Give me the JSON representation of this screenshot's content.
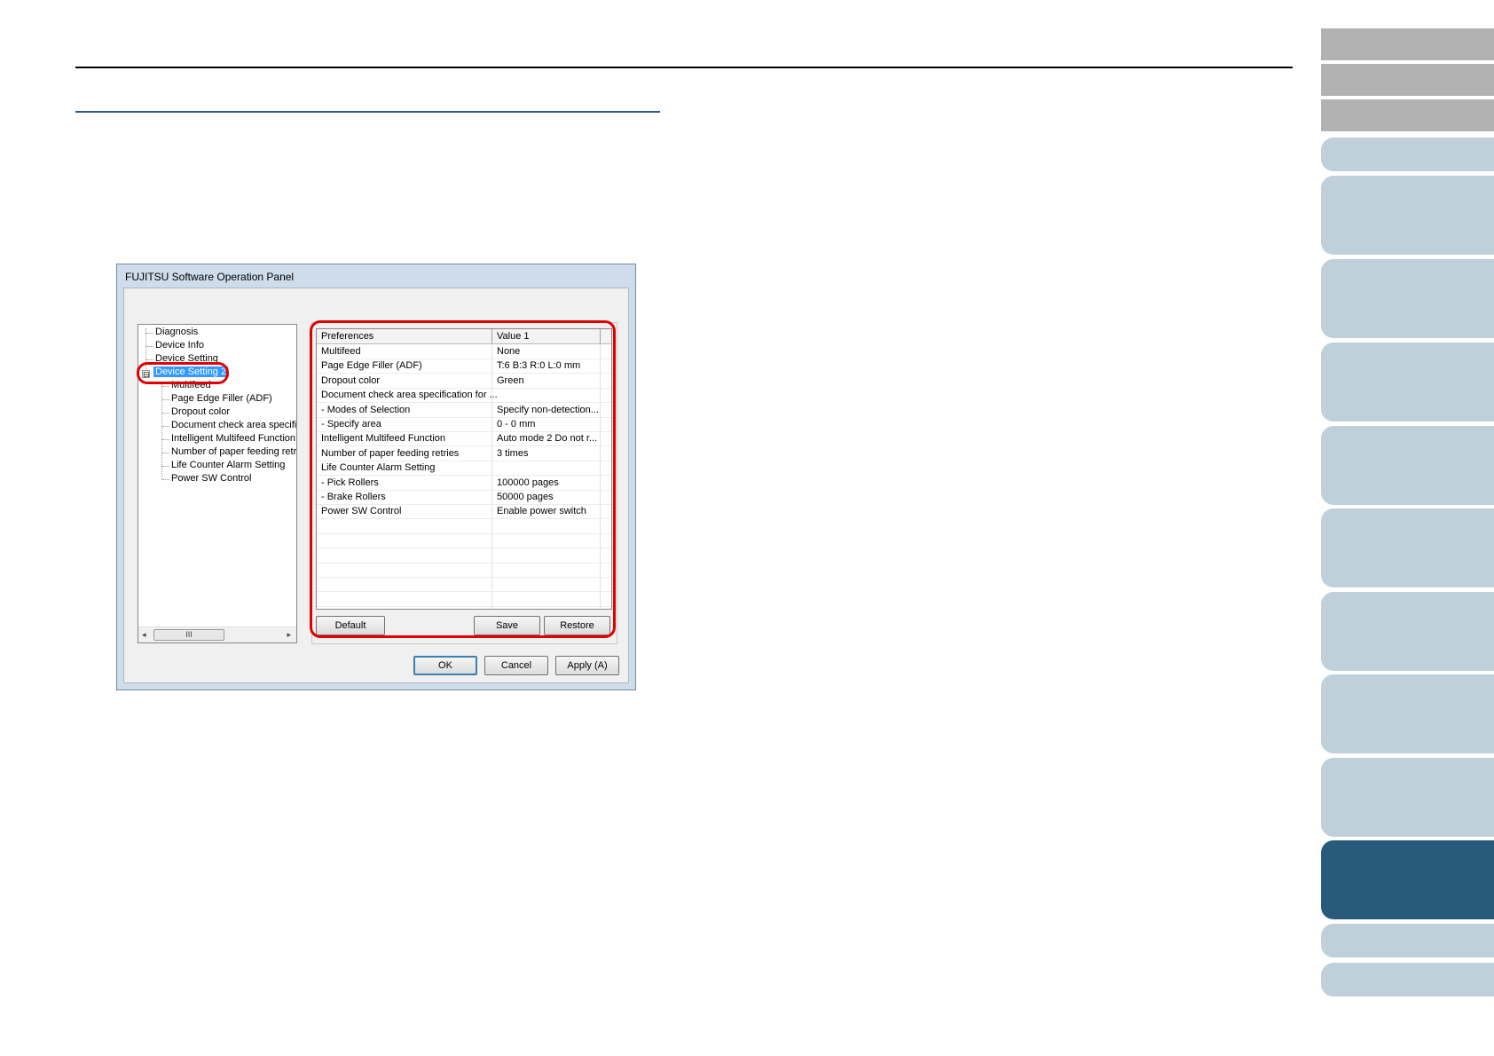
{
  "dialog": {
    "title": "FUJITSU Software Operation Panel",
    "tree": {
      "items": [
        {
          "label": "Diagnosis"
        },
        {
          "label": "Device Info"
        },
        {
          "label": "Device Setting"
        },
        {
          "label": "Device Setting 2",
          "selected": true,
          "expander": "⊟"
        },
        {
          "label": "Multifeed"
        },
        {
          "label": "Page Edge Filler (ADF)"
        },
        {
          "label": "Dropout color"
        },
        {
          "label": "Document check area specific"
        },
        {
          "label": "Intelligent Multifeed Function"
        },
        {
          "label": "Number of paper feeding retrie"
        },
        {
          "label": "Life Counter Alarm Setting"
        },
        {
          "label": "Power SW Control"
        }
      ],
      "scroll_thumb": "III",
      "scroll_left": "◂",
      "scroll_right": "▸"
    },
    "grid": {
      "headers": [
        "Preferences",
        "Value 1"
      ],
      "rows": [
        {
          "pref": "Multifeed",
          "value": "None"
        },
        {
          "pref": "Page Edge Filler (ADF)",
          "value": "T:6  B:3  R:0  L:0 mm"
        },
        {
          "pref": "Dropout color",
          "value": "Green"
        },
        {
          "pref": "Document check area specification for ...",
          "value": ""
        },
        {
          "pref": " - Modes of Selection",
          "value": "Specify non-detection..."
        },
        {
          "pref": " - Specify area",
          "value": "0 - 0 mm"
        },
        {
          "pref": "Intelligent Multifeed Function",
          "value": "Auto mode 2  Do not r..."
        },
        {
          "pref": "Number of paper feeding retries",
          "value": "3 times"
        },
        {
          "pref": "Life Counter Alarm Setting",
          "value": ""
        },
        {
          "pref": " - Pick Rollers",
          "value": "100000 pages"
        },
        {
          "pref": " - Brake Rollers",
          "value": "50000 pages"
        },
        {
          "pref": "Power SW Control",
          "value": "Enable power switch"
        },
        {
          "pref": "",
          "value": ""
        },
        {
          "pref": "",
          "value": ""
        },
        {
          "pref": "",
          "value": ""
        },
        {
          "pref": "",
          "value": ""
        },
        {
          "pref": "",
          "value": ""
        },
        {
          "pref": "",
          "value": ""
        }
      ]
    },
    "panel_buttons": {
      "default": "Default",
      "save": "Save",
      "restore": "Restore"
    },
    "footer_buttons": {
      "ok": "OK",
      "cancel": "Cancel",
      "apply": "Apply (A)"
    }
  },
  "colors": {
    "highlight_ring": "#e00000",
    "selected_item": "#3399ff",
    "side_tab_light": "#bfd0da",
    "side_tab_active": "#285a7b",
    "side_tab_grey": "#b2b2b2",
    "section_rule": "#2e5a7e"
  },
  "side_tabs": {
    "count": 14,
    "active_index": 11
  }
}
